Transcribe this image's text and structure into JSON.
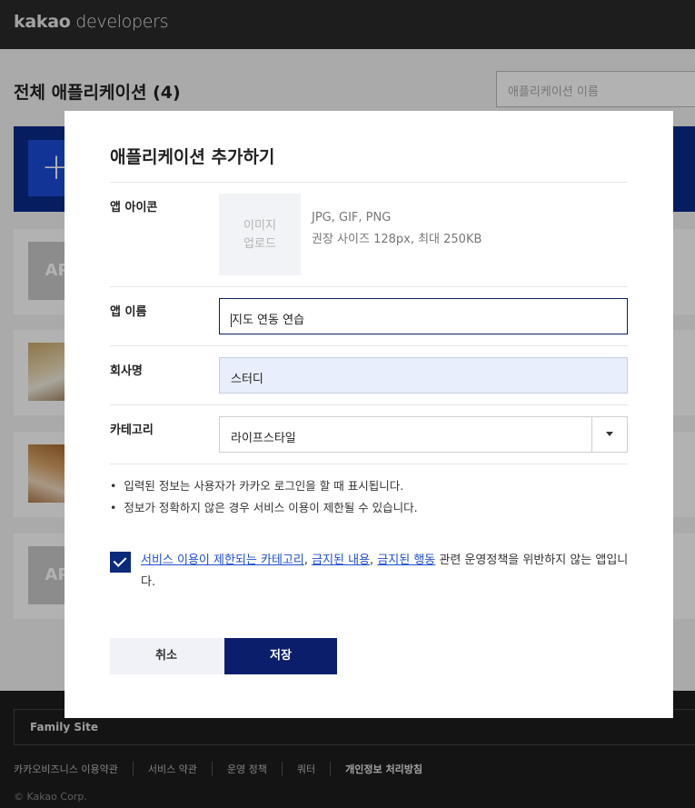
{
  "header": {
    "brand_strong": "kakao",
    "brand_light": "developers"
  },
  "page": {
    "title": "전체 애플리케이션 (4)",
    "search_placeholder": "애플리케이션 이름",
    "add_symbol": "+",
    "app_placeholder_text": "AP"
  },
  "modal": {
    "title": "애플리케이션 추가하기",
    "icon_label": "앱 아이콘",
    "upload_line1": "이미지",
    "upload_line2": "업로드",
    "icon_formats": "JPG, GIF, PNG",
    "icon_recommend": "권장 사이즈 128px, 최대 250KB",
    "name_label": "앱 이름",
    "name_value": "지도 연동 연습",
    "company_label": "회사명",
    "company_value": "스터디",
    "category_label": "카테고리",
    "category_value": "라이프스타일",
    "notes": [
      "입력된 정보는 사용자가 카카오 로그인을 할 때 표시됩니다.",
      "정보가 정확하지 않은 경우 서비스 이용이 제한될 수 있습니다."
    ],
    "agree": {
      "link1": "서비스 이용이 제한되는 카테고리",
      "sep1": ", ",
      "link2": "금지된 내용",
      "sep2": ", ",
      "link3": "금지된 행동",
      "rest": " 관련 운영정책을 위반하지 않는 앱입니다."
    },
    "cancel_label": "취소",
    "save_label": "저장"
  },
  "footer": {
    "family_site": "Family Site",
    "links": [
      "카카오비즈니스 이용약관",
      "서비스 약관",
      "운영 정책",
      "쿼터",
      "개인정보 처리방침"
    ],
    "copyright": "© Kakao Corp."
  },
  "colors": {
    "primary": "#0b1e6b",
    "link": "#1f4fd1",
    "header_bg": "#2a2a2a"
  }
}
